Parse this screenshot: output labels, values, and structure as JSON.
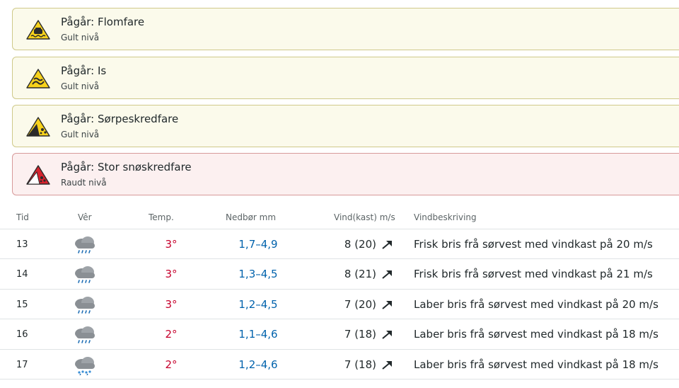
{
  "warnings": [
    {
      "status": "Pågår: Flomfare",
      "level": "Gult nivå",
      "icon": "flood-warning-icon",
      "color": "yellow"
    },
    {
      "status": "Pågår: Is",
      "level": "Gult nivå",
      "icon": "ice-warning-icon",
      "color": "yellow"
    },
    {
      "status": "Pågår: Sørpeskredfare",
      "level": "Gult nivå",
      "icon": "slush-avalanche-warning-icon",
      "color": "yellow"
    },
    {
      "status": "Pågår: Stor snøskredfare",
      "level": "Raudt nivå",
      "icon": "snow-avalanche-warning-icon",
      "color": "red"
    }
  ],
  "table": {
    "headers": {
      "time": "Tid",
      "weather": "Vêr",
      "temp": "Temp.",
      "precip": "Nedbør mm",
      "wind": "Vind(kast) m/s",
      "desc": "Vindbeskriving"
    },
    "rows": [
      {
        "time": "13",
        "icon": "heavy-rain-cloud-icon",
        "temp": "3°",
        "precip": "1,7–4,9",
        "wind": "8 (20)",
        "desc": "Frisk bris frå sørvest med vindkast på 20 m/s"
      },
      {
        "time": "14",
        "icon": "heavy-rain-cloud-icon",
        "temp": "3°",
        "precip": "1,3–4,5",
        "wind": "8 (21)",
        "desc": "Frisk bris frå sørvest med vindkast på 21 m/s"
      },
      {
        "time": "15",
        "icon": "heavy-rain-cloud-icon",
        "temp": "3°",
        "precip": "1,2–4,5",
        "wind": "7 (20)",
        "desc": "Laber bris frå sørvest med vindkast på 20 m/s"
      },
      {
        "time": "16",
        "icon": "heavy-rain-cloud-icon",
        "temp": "2°",
        "precip": "1,1–4,6",
        "wind": "7 (18)",
        "desc": "Laber bris frå sørvest med vindkast på 18 m/s"
      },
      {
        "time": "17",
        "icon": "heavy-sleet-cloud-icon",
        "temp": "2°",
        "precip": "1,2–4,6",
        "wind": "7 (18)",
        "desc": "Laber bris frå sørvest med vindkast på 18 m/s"
      }
    ]
  },
  "colors": {
    "yellow_bg": "#fbfaeb",
    "red_bg": "#fcf0f0",
    "temp_red": "#c6002c",
    "precip_blue": "#0062ac"
  }
}
